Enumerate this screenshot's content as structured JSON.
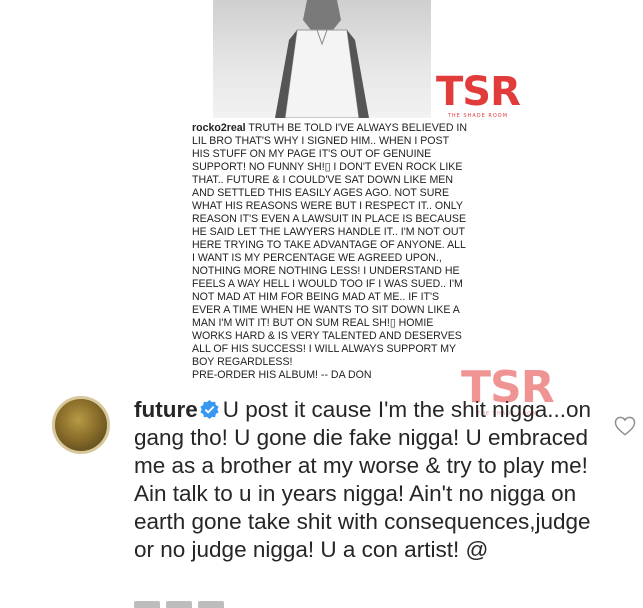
{
  "post": {
    "caption_user": "rocko2real",
    "caption_body": "TRUTH BE TOLD I'VE ALWAYS BELIEVED IN LIL BRO THAT'S WHY I SIGNED HIM.. WHEN I POST HIS STUFF ON MY PAGE IT'S OUT OF GENUINE SUPPORT! NO FUNNY SH!▯ I DON'T EVEN ROCK LIKE THAT.. FUTURE & I COULD'VE SAT DOWN LIKE MEN AND SETTLED THIS EASILY AGES AGO. NOT SURE WHAT HIS REASONS WERE BUT I RESPECT IT.. ONLY REASON IT'S EVEN A LAWSUIT IN PLACE IS BECAUSE HE SAID LET THE LAWYERS HANDLE IT.. I'M NOT OUT HERE TRYING TO TAKE ADVANTAGE OF ANYONE. ALL I WANT IS MY PERCENTAGE WE AGREED UPON., NOTHING MORE NOTHING LESS! I UNDERSTAND HE FEELS A WAY HELL I WOULD TOO IF I WAS SUED.. I'M NOT MAD AT HIM FOR BEING MAD AT ME.. IF IT'S EVER A TIME WHEN HE WANTS TO SIT DOWN LIKE A MAN I'M WIT IT! BUT ON SUM REAL SH!▯ HOMIE WORKS HARD & IS VERY TALENTED AND DESERVES ALL OF HIS SUCCESS! I WILL ALWAYS SUPPORT MY BOY REGARDLESS!",
    "caption_preorder": "PRE-ORDER HIS ALBUM! -- DA DON"
  },
  "watermark": {
    "mark": "TSR",
    "sub": "THE SHADE ROOM",
    "color": "#e23b3b"
  },
  "comment": {
    "username": "future",
    "text": "U post it cause I'm the shit nigga...on gang tho! U gone die fake nigga! U embraced me as a brother at my worse & try to play me! Ain talk to u in years nigga! Ain't no nigga on earth gone take shit with consequences,judge or no judge nigga! U a con artist!  @",
    "verified_color": "#3897f0"
  },
  "icons": {
    "verified": "verified-badge-icon",
    "like": "heart-outline-icon"
  }
}
